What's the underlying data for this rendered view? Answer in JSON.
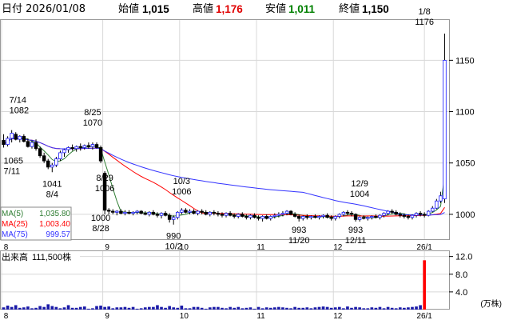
{
  "header": {
    "date": "日付 2026/01/08",
    "open_label": "始値",
    "open_value": "1,015",
    "high_label": "高値",
    "high_value": "1,176",
    "low_label": "安値",
    "low_value": "1,011",
    "close_label": "終値",
    "close_value": "1,150"
  },
  "colors": {
    "up": "#1a1aff",
    "down": "#000000",
    "high": "#ff0000",
    "low": "#007f00",
    "ma5": "#2e7d32",
    "ma25": "#ff0000",
    "ma75": "#3333ff",
    "volume": "#1a1aa8",
    "volume_last": "#ff0000"
  },
  "chart_data": [
    {
      "type": "candlestick",
      "ylim": [
        975,
        1190
      ],
      "y_ticks": [
        "1000",
        "1050",
        "1100",
        "1150"
      ],
      "x_ticks": [
        "8",
        "9",
        "10",
        "11",
        "12",
        "26/1"
      ],
      "legend": [
        {
          "name": "MA(5)",
          "value": "1,035.80"
        },
        {
          "name": "MA(25)",
          "value": "1,003.40"
        },
        {
          "name": "MA(75)",
          "value": "999.57"
        }
      ],
      "annotations": [
        {
          "date": "7/14",
          "value": "1082"
        },
        {
          "date": "7/11",
          "value": "1065"
        },
        {
          "date": "8/4",
          "value": "1041"
        },
        {
          "date": "8/25",
          "value": "1070"
        },
        {
          "date": "8/29",
          "value": "1006"
        },
        {
          "date": "8/28",
          "value": "1000"
        },
        {
          "date": "10/3",
          "value": "1006"
        },
        {
          "date": "10/2",
          "value": "990"
        },
        {
          "date": "11/20",
          "value": "993"
        },
        {
          "date": "12/9",
          "value": "1004"
        },
        {
          "date": "12/11",
          "value": "993"
        },
        {
          "date": "1/8",
          "value": "1176"
        }
      ],
      "ohlc": [
        [
          1072,
          1078,
          1065,
          1068
        ],
        [
          1068,
          1076,
          1066,
          1074
        ],
        [
          1074,
          1082,
          1070,
          1079
        ],
        [
          1078,
          1080,
          1072,
          1073
        ],
        [
          1073,
          1077,
          1070,
          1076
        ],
        [
          1076,
          1078,
          1070,
          1071
        ],
        [
          1071,
          1074,
          1065,
          1066
        ],
        [
          1066,
          1072,
          1064,
          1070
        ],
        [
          1070,
          1073,
          1062,
          1064
        ],
        [
          1064,
          1066,
          1055,
          1057
        ],
        [
          1057,
          1060,
          1050,
          1052
        ],
        [
          1052,
          1054,
          1044,
          1046
        ],
        [
          1046,
          1050,
          1041,
          1048
        ],
        [
          1048,
          1056,
          1046,
          1054
        ],
        [
          1054,
          1062,
          1052,
          1060
        ],
        [
          1060,
          1064,
          1056,
          1063
        ],
        [
          1063,
          1066,
          1060,
          1065
        ],
        [
          1065,
          1068,
          1062,
          1064
        ],
        [
          1064,
          1067,
          1061,
          1066
        ],
        [
          1066,
          1069,
          1062,
          1065
        ],
        [
          1065,
          1068,
          1063,
          1067
        ],
        [
          1067,
          1070,
          1064,
          1066
        ],
        [
          1066,
          1070,
          1063,
          1068
        ],
        [
          1068,
          1070,
          1064,
          1065
        ],
        [
          1065,
          1067,
          1050,
          1052
        ],
        [
          1040,
          1042,
          1000,
          1004
        ],
        [
          1004,
          1006,
          1000,
          1003
        ],
        [
          1003,
          1005,
          1000,
          1002
        ],
        [
          1002,
          1004,
          999,
          1003
        ],
        [
          1003,
          1005,
          1000,
          1001
        ],
        [
          1001,
          1004,
          999,
          1002
        ],
        [
          1002,
          1004,
          1000,
          1001
        ],
        [
          1001,
          1003,
          999,
          1002
        ],
        [
          1002,
          1004,
          1000,
          1003
        ],
        [
          1003,
          1004,
          1000,
          1001
        ],
        [
          1001,
          1003,
          999,
          1000
        ],
        [
          1000,
          1003,
          998,
          1002
        ],
        [
          1002,
          1004,
          999,
          1000
        ],
        [
          1000,
          1002,
          997,
          999
        ],
        [
          999,
          1002,
          996,
          1001
        ],
        [
          1001,
          1003,
          998,
          999
        ],
        [
          999,
          1001,
          992,
          995
        ],
        [
          995,
          999,
          990,
          997
        ],
        [
          997,
          1003,
          995,
          1002
        ],
        [
          1002,
          1006,
          1000,
          1004
        ],
        [
          1004,
          1006,
          1001,
          1002
        ],
        [
          1002,
          1005,
          1000,
          1003
        ],
        [
          1003,
          1005,
          1000,
          1001
        ],
        [
          1001,
          1004,
          999,
          1003
        ],
        [
          1003,
          1005,
          1000,
          1002
        ],
        [
          1002,
          1004,
          999,
          1000
        ],
        [
          1000,
          1003,
          998,
          1002
        ],
        [
          1002,
          1004,
          999,
          1001
        ],
        [
          1001,
          1003,
          998,
          1000
        ],
        [
          1000,
          1002,
          997,
          999
        ],
        [
          999,
          1002,
          997,
          1001
        ],
        [
          1001,
          1003,
          998,
          999
        ],
        [
          999,
          1001,
          996,
          998
        ],
        [
          998,
          1001,
          996,
          1000
        ],
        [
          1000,
          1002,
          997,
          998
        ],
        [
          998,
          1000,
          995,
          997
        ],
        [
          997,
          1000,
          995,
          999
        ],
        [
          999,
          1001,
          996,
          997
        ],
        [
          997,
          999,
          994,
          996
        ],
        [
          996,
          999,
          993,
          998
        ],
        [
          998,
          1000,
          995,
          996
        ],
        [
          996,
          999,
          994,
          998
        ],
        [
          998,
          1001,
          996,
          999
        ],
        [
          999,
          1002,
          997,
          1000
        ],
        [
          1000,
          1003,
          998,
          1001
        ],
        [
          1001,
          1004,
          999,
          1003
        ],
        [
          1003,
          1004,
          999,
          1000
        ],
        [
          1000,
          1002,
          997,
          998
        ],
        [
          998,
          1000,
          993,
          996
        ],
        [
          996,
          999,
          994,
          998
        ],
        [
          998,
          1000,
          995,
          997
        ],
        [
          997,
          999,
          995,
          998
        ],
        [
          998,
          1000,
          996,
          997
        ],
        [
          997,
          999,
          995,
          998
        ],
        [
          998,
          1000,
          996,
          999
        ],
        [
          999,
          1001,
          996,
          997
        ],
        [
          997,
          999,
          994,
          996
        ],
        [
          996,
          999,
          994,
          998
        ],
        [
          998,
          1001,
          996,
          1000
        ],
        [
          1000,
          1003,
          998,
          1002
        ],
        [
          1002,
          1004,
          999,
          1001
        ],
        [
          1001,
          1003,
          998,
          1000
        ],
        [
          1000,
          1001,
          993,
          995
        ],
        [
          995,
          998,
          993,
          997
        ],
        [
          997,
          999,
          995,
          996
        ],
        [
          996,
          998,
          994,
          997
        ],
        [
          997,
          999,
          995,
          998
        ],
        [
          998,
          1000,
          996,
          997
        ],
        [
          997,
          1000,
          995,
          999
        ],
        [
          999,
          1002,
          997,
          1001
        ],
        [
          1001,
          1004,
          999,
          1003
        ],
        [
          1003,
          1005,
          1000,
          1002
        ],
        [
          1002,
          1004,
          999,
          1000
        ],
        [
          1000,
          1002,
          997,
          999
        ],
        [
          999,
          1001,
          996,
          998
        ],
        [
          998,
          1000,
          995,
          997
        ],
        [
          997,
          1000,
          995,
          999
        ],
        [
          999,
          1002,
          997,
          1001
        ],
        [
          1001,
          1003,
          998,
          1000
        ],
        [
          1000,
          1002,
          997,
          999
        ],
        [
          999,
          1004,
          998,
          1003
        ],
        [
          1003,
          1008,
          1002,
          1006
        ],
        [
          1006,
          1015,
          1005,
          1013
        ],
        [
          1013,
          1022,
          1011,
          1018
        ],
        [
          1015,
          1176,
          1011,
          1150
        ]
      ]
    },
    {
      "type": "bar",
      "title": "出来高",
      "value_label": "111,500株",
      "unit": "(万株)",
      "y_ticks": [
        "4.0",
        "8.0",
        "12.0"
      ],
      "ylim": [
        0,
        13.2
      ],
      "values": [
        0.5,
        0.9,
        0.6,
        1.0,
        0.4,
        0.5,
        0.7,
        0.3,
        0.4,
        0.8,
        0.6,
        1.2,
        0.8,
        0.6,
        0.3,
        0.5,
        1.0,
        0.4,
        0.4,
        0.6,
        0.7,
        0.2,
        0.3,
        0.8,
        0.9,
        0.6,
        0.7,
        0.3,
        0.5,
        0.5,
        0.6,
        0.4,
        0.6,
        0.2,
        0.3,
        0.5,
        0.6,
        0.6,
        1.0,
        0.6,
        0.4,
        0.8,
        0.5,
        0.4,
        0.9,
        0.3,
        0.3,
        0.6,
        0.6,
        0.4,
        0.2,
        0.5,
        0.6,
        0.6,
        0.4,
        0.3,
        0.6,
        0.4,
        0.6,
        0.3,
        0.4,
        0.5,
        0.2,
        0.6,
        0.3,
        0.5,
        0.4,
        0.5,
        0.6,
        0.5,
        0.4,
        0.3,
        0.6,
        0.4,
        0.4,
        0.5,
        0.3,
        0.5,
        0.6,
        0.7,
        0.6,
        0.4,
        0.5,
        0.6,
        0.3,
        0.7,
        0.4,
        0.6,
        0.5,
        0.3,
        0.3,
        0.5,
        0.4,
        0.6,
        0.3,
        0.6,
        0.4,
        0.3,
        0.5,
        0.4,
        0.5,
        0.6,
        0.7,
        1.0,
        11.15
      ]
    }
  ]
}
